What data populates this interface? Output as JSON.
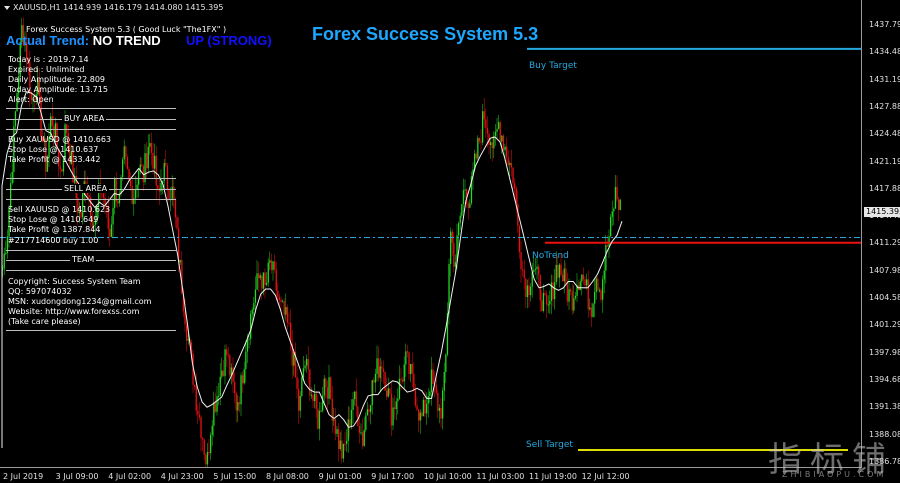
{
  "header": {
    "symbol_line": "XAUUSD,H1  1414.939 1416.179 1414.080 1415.395"
  },
  "indicator": {
    "name_line": "Forex Success System 5.3 ( Good Luck \"The1FX\" )",
    "title": "Forex Success System 5.3",
    "trend_label": "Actual Trend:",
    "trend_value": "NO TREND",
    "trend_strong": "UP (STRONG)"
  },
  "info": {
    "today": "Today is   :  2019.7.14",
    "expired": "Expired  :  Unlimited",
    "daily_amp": "Daily Amplitude:   22.809",
    "today_amp": "Today Amplitude:   13.715",
    "alert": "Alert:          Open",
    "buy_area": "BUY AREA",
    "buy": "Buy  XAUUSD    @ 1410.663",
    "buy_stop": "Stop Lose        @ 1410.637",
    "buy_tp": "Take Profit       @ 1433.442",
    "sell_area": "SELL AREA",
    "sell": "Sell  XAUUSD    @ 1410.623",
    "sell_stop": "Stop Lose        @ 1410.649",
    "sell_tp": "Take Profit       @ 1387.844",
    "order": "#217714600 buy 1.00",
    "team": "TEAM",
    "copyright": "Copyright: Success System Team",
    "qq": "QQ:      597074032",
    "msn": "MSN: xudongdong1234@gmail.com",
    "website": "Website: http://www.forexss.com",
    "care": "(Take care please)"
  },
  "targets": {
    "buy_label": "Buy Target",
    "sell_label": "Sell Target",
    "no_trend_label": "NoTrend"
  },
  "price_axis": {
    "ticks": [
      "1437.790",
      "1434.480",
      "1431.190",
      "1427.880",
      "1424.480",
      "1421.190",
      "1417.880",
      "1414.480",
      "1411.290",
      "1407.980",
      "1404.580",
      "1401.290",
      "1397.980",
      "1394.680",
      "1391.380",
      "1388.080",
      "1386.780"
    ],
    "current": "1415.395"
  },
  "time_axis": {
    "ticks": [
      "2 Jul 2019",
      "3 Jul 09:00",
      "4 Jul 02:00",
      "4 Jul 23:00",
      "5 Jul 15:00",
      "8 Jul 08:00",
      "9 Jul 01:00",
      "9 Jul 17:00",
      "10 Jul 10:00",
      "11 Jul 03:00",
      "11 Jul 19:00",
      "12 Jul 12:00"
    ]
  },
  "watermark": {
    "main": "指标铺",
    "sub": "ZHIBIAOPU.COM"
  },
  "colors": {
    "bull": "#22dd22",
    "bear": "#ee1111",
    "buy_target": "#26a9e0",
    "sell_target": "#dddd00",
    "dash_line": "#26a9e0",
    "stop_line": "#ee1111",
    "trend_blue": "#1e90ff"
  },
  "chart_data": {
    "type": "candlestick",
    "symbol": "XAUUSD",
    "timeframe": "H1",
    "ylim": [
      1385.8,
      1439.0
    ],
    "ohlc_header": [
      1414.939,
      1416.179,
      1414.08,
      1415.395
    ],
    "buy_target": 1433.442,
    "sell_target": 1387.844,
    "dashed_level": 1412.0,
    "red_level": 1411.4,
    "path": [
      1408.5,
      1413,
      1421,
      1429,
      1436,
      1433,
      1427,
      1430,
      1424,
      1420,
      1426,
      1423,
      1419,
      1425,
      1421,
      1417,
      1414,
      1419,
      1416,
      1413,
      1418,
      1416,
      1412,
      1418,
      1416,
      1421,
      1418,
      1417,
      1420,
      1419,
      1423,
      1421,
      1416,
      1420,
      1418,
      1417,
      1411,
      1406,
      1401,
      1397,
      1393,
      1390,
      1386,
      1392,
      1394,
      1397,
      1399,
      1396,
      1393,
      1395,
      1400,
      1403,
      1406,
      1408,
      1406,
      1409,
      1407,
      1404,
      1403,
      1401,
      1397,
      1392,
      1398,
      1396,
      1393,
      1391,
      1396,
      1395,
      1392,
      1389,
      1387,
      1390,
      1394,
      1392,
      1389,
      1393,
      1395,
      1397,
      1398,
      1395,
      1392,
      1394,
      1396,
      1398,
      1396,
      1394,
      1391,
      1393,
      1396,
      1394,
      1392,
      1396,
      1413,
      1409,
      1414,
      1418,
      1416,
      1420,
      1423,
      1426,
      1424,
      1422,
      1425,
      1423,
      1421,
      1419,
      1413,
      1408,
      1406,
      1409,
      1407,
      1405,
      1403,
      1406,
      1409,
      1408,
      1406,
      1405,
      1407,
      1408,
      1406,
      1404,
      1408,
      1406,
      1410,
      1413,
      1417,
      1415.4
    ]
  }
}
